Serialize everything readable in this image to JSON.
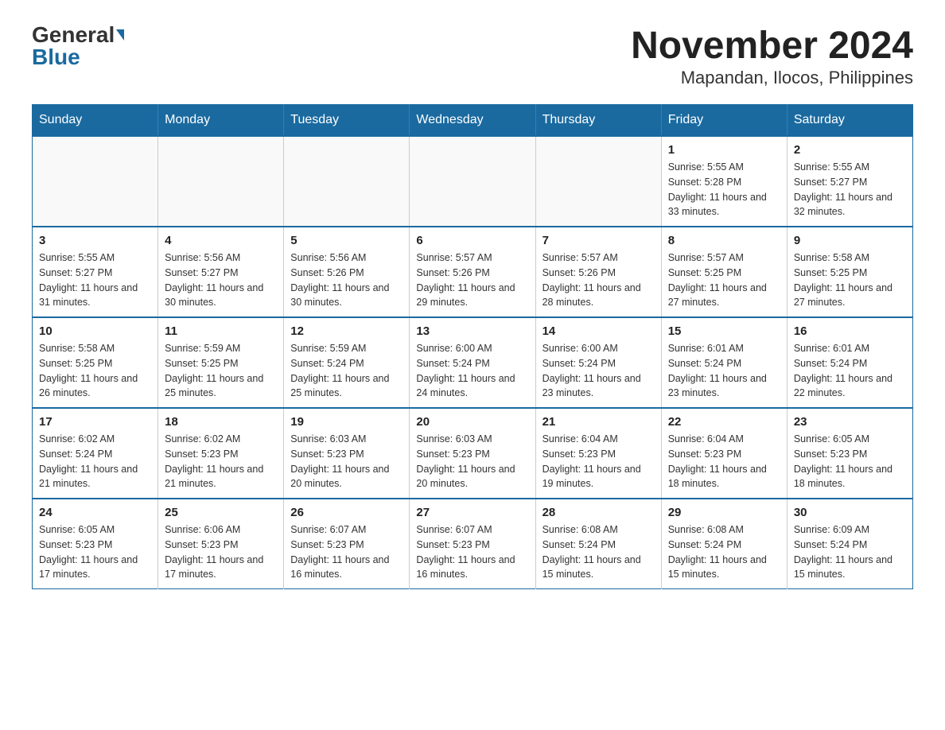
{
  "logo": {
    "general": "General",
    "blue": "Blue"
  },
  "title": "November 2024",
  "subtitle": "Mapandan, Ilocos, Philippines",
  "weekdays": [
    "Sunday",
    "Monday",
    "Tuesday",
    "Wednesday",
    "Thursday",
    "Friday",
    "Saturday"
  ],
  "weeks": [
    [
      {
        "day": "",
        "info": ""
      },
      {
        "day": "",
        "info": ""
      },
      {
        "day": "",
        "info": ""
      },
      {
        "day": "",
        "info": ""
      },
      {
        "day": "",
        "info": ""
      },
      {
        "day": "1",
        "info": "Sunrise: 5:55 AM\nSunset: 5:28 PM\nDaylight: 11 hours and 33 minutes."
      },
      {
        "day": "2",
        "info": "Sunrise: 5:55 AM\nSunset: 5:27 PM\nDaylight: 11 hours and 32 minutes."
      }
    ],
    [
      {
        "day": "3",
        "info": "Sunrise: 5:55 AM\nSunset: 5:27 PM\nDaylight: 11 hours and 31 minutes."
      },
      {
        "day": "4",
        "info": "Sunrise: 5:56 AM\nSunset: 5:27 PM\nDaylight: 11 hours and 30 minutes."
      },
      {
        "day": "5",
        "info": "Sunrise: 5:56 AM\nSunset: 5:26 PM\nDaylight: 11 hours and 30 minutes."
      },
      {
        "day": "6",
        "info": "Sunrise: 5:57 AM\nSunset: 5:26 PM\nDaylight: 11 hours and 29 minutes."
      },
      {
        "day": "7",
        "info": "Sunrise: 5:57 AM\nSunset: 5:26 PM\nDaylight: 11 hours and 28 minutes."
      },
      {
        "day": "8",
        "info": "Sunrise: 5:57 AM\nSunset: 5:25 PM\nDaylight: 11 hours and 27 minutes."
      },
      {
        "day": "9",
        "info": "Sunrise: 5:58 AM\nSunset: 5:25 PM\nDaylight: 11 hours and 27 minutes."
      }
    ],
    [
      {
        "day": "10",
        "info": "Sunrise: 5:58 AM\nSunset: 5:25 PM\nDaylight: 11 hours and 26 minutes."
      },
      {
        "day": "11",
        "info": "Sunrise: 5:59 AM\nSunset: 5:25 PM\nDaylight: 11 hours and 25 minutes."
      },
      {
        "day": "12",
        "info": "Sunrise: 5:59 AM\nSunset: 5:24 PM\nDaylight: 11 hours and 25 minutes."
      },
      {
        "day": "13",
        "info": "Sunrise: 6:00 AM\nSunset: 5:24 PM\nDaylight: 11 hours and 24 minutes."
      },
      {
        "day": "14",
        "info": "Sunrise: 6:00 AM\nSunset: 5:24 PM\nDaylight: 11 hours and 23 minutes."
      },
      {
        "day": "15",
        "info": "Sunrise: 6:01 AM\nSunset: 5:24 PM\nDaylight: 11 hours and 23 minutes."
      },
      {
        "day": "16",
        "info": "Sunrise: 6:01 AM\nSunset: 5:24 PM\nDaylight: 11 hours and 22 minutes."
      }
    ],
    [
      {
        "day": "17",
        "info": "Sunrise: 6:02 AM\nSunset: 5:24 PM\nDaylight: 11 hours and 21 minutes."
      },
      {
        "day": "18",
        "info": "Sunrise: 6:02 AM\nSunset: 5:23 PM\nDaylight: 11 hours and 21 minutes."
      },
      {
        "day": "19",
        "info": "Sunrise: 6:03 AM\nSunset: 5:23 PM\nDaylight: 11 hours and 20 minutes."
      },
      {
        "day": "20",
        "info": "Sunrise: 6:03 AM\nSunset: 5:23 PM\nDaylight: 11 hours and 20 minutes."
      },
      {
        "day": "21",
        "info": "Sunrise: 6:04 AM\nSunset: 5:23 PM\nDaylight: 11 hours and 19 minutes."
      },
      {
        "day": "22",
        "info": "Sunrise: 6:04 AM\nSunset: 5:23 PM\nDaylight: 11 hours and 18 minutes."
      },
      {
        "day": "23",
        "info": "Sunrise: 6:05 AM\nSunset: 5:23 PM\nDaylight: 11 hours and 18 minutes."
      }
    ],
    [
      {
        "day": "24",
        "info": "Sunrise: 6:05 AM\nSunset: 5:23 PM\nDaylight: 11 hours and 17 minutes."
      },
      {
        "day": "25",
        "info": "Sunrise: 6:06 AM\nSunset: 5:23 PM\nDaylight: 11 hours and 17 minutes."
      },
      {
        "day": "26",
        "info": "Sunrise: 6:07 AM\nSunset: 5:23 PM\nDaylight: 11 hours and 16 minutes."
      },
      {
        "day": "27",
        "info": "Sunrise: 6:07 AM\nSunset: 5:23 PM\nDaylight: 11 hours and 16 minutes."
      },
      {
        "day": "28",
        "info": "Sunrise: 6:08 AM\nSunset: 5:24 PM\nDaylight: 11 hours and 15 minutes."
      },
      {
        "day": "29",
        "info": "Sunrise: 6:08 AM\nSunset: 5:24 PM\nDaylight: 11 hours and 15 minutes."
      },
      {
        "day": "30",
        "info": "Sunrise: 6:09 AM\nSunset: 5:24 PM\nDaylight: 11 hours and 15 minutes."
      }
    ]
  ]
}
